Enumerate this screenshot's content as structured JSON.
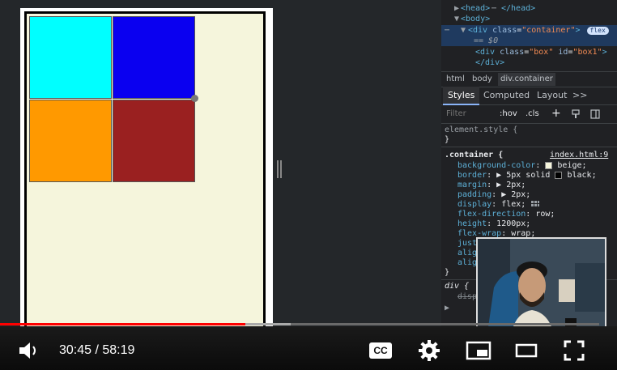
{
  "page": {
    "boxes": [
      {
        "id": "box1",
        "color": "#00ffff"
      },
      {
        "id": "box2",
        "color": "#0a00f0"
      },
      {
        "id": "box3",
        "color": "#ff9900"
      },
      {
        "id": "box4",
        "color": "#9a2020"
      }
    ]
  },
  "devtools": {
    "dom": {
      "line1": {
        "collapsed": "▶",
        "open": "<head>",
        "dots": "⋯",
        "close": "</head>"
      },
      "line2": {
        "arrow": "▼",
        "tag": "<body>"
      },
      "line3": {
        "dots": "⋯",
        "arrow": "▼",
        "open": "<div ",
        "attr_name": "class",
        "attr_value": "\"container\"",
        "end": ">",
        "badge": "flex"
      },
      "line3b": "== $0",
      "line4": {
        "open": "<div ",
        "a1": "class",
        "v1": "\"box\"",
        "a2": "id",
        "v2": "\"box1\"",
        "end": ">"
      },
      "line5": "</div>"
    },
    "breadcrumbs": [
      "html",
      "body",
      "div.container"
    ],
    "tabs": [
      "Styles",
      "Computed",
      "Layout",
      ">>"
    ],
    "filter": {
      "placeholder": "Filter",
      "hov": ":hov",
      "cls": ".cls",
      "plus": "+"
    },
    "element_style": {
      "selector": "element.style {",
      "close": "}"
    },
    "container_rule": {
      "selector": ".container {",
      "source": "index.html:9",
      "declarations": [
        {
          "prop": "background-color",
          "value": "beige;",
          "swatch": "#f5f5dc"
        },
        {
          "prop": "border",
          "value": "▶ 5px solid",
          "swatch": "#000000",
          "value2": "black;"
        },
        {
          "prop": "margin",
          "value": "▶ 2px;"
        },
        {
          "prop": "padding",
          "value": "▶ 2px;"
        },
        {
          "prop": "display",
          "value": "flex;"
        },
        {
          "prop": "flex-direction",
          "value": "row;"
        },
        {
          "prop": "height",
          "value": "1200px;"
        },
        {
          "prop": "flex-wrap",
          "value": "wrap;"
        },
        {
          "prop": "just",
          "value": ""
        },
        {
          "prop": "alig",
          "value": ""
        },
        {
          "prop": "alig",
          "value": ""
        }
      ],
      "close": "}"
    },
    "div_rule": {
      "selector": "div {",
      "prop": "disp"
    }
  },
  "player": {
    "time": "30:45 / 58:19",
    "progress_played": 0.41,
    "progress_buffered": 0.485,
    "icons": [
      "volume-icon",
      "captions-icon",
      "settings-icon",
      "miniplayer-icon",
      "theater-mode-icon",
      "fullscreen-icon"
    ],
    "cc_label": "CC"
  }
}
